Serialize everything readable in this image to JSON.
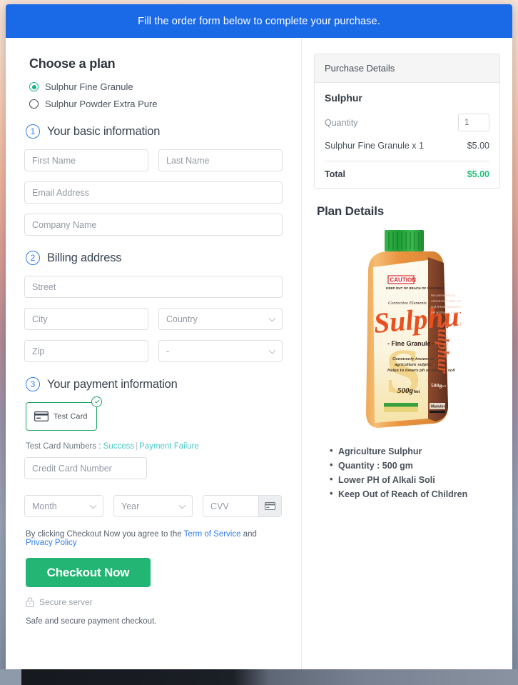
{
  "banner": {
    "text": "Fill the order form below to complete your purchase."
  },
  "plan": {
    "heading": "Choose a plan",
    "options": [
      {
        "label": "Sulphur Fine Granule",
        "selected": true
      },
      {
        "label": "Sulphur Powder Extra Pure",
        "selected": false
      }
    ]
  },
  "steps": {
    "basic": {
      "num": "1",
      "title": "Your basic information"
    },
    "billing": {
      "num": "2",
      "title": "Billing address"
    },
    "payment": {
      "num": "3",
      "title": "Your payment information"
    }
  },
  "fields": {
    "first_name": {
      "placeholder": "First Name",
      "value": ""
    },
    "last_name": {
      "placeholder": "Last Name",
      "value": ""
    },
    "email": {
      "placeholder": "Email Address",
      "value": ""
    },
    "company": {
      "placeholder": "Company Name",
      "value": ""
    },
    "street": {
      "placeholder": "Street",
      "value": ""
    },
    "city": {
      "placeholder": "City",
      "value": ""
    },
    "country": {
      "placeholder": "Country",
      "value": ""
    },
    "zip": {
      "placeholder": "Zip",
      "value": ""
    },
    "state": {
      "placeholder": "-",
      "value": ""
    },
    "credit_card": {
      "placeholder": "Credit Card Number",
      "value": ""
    },
    "month": {
      "placeholder": "Month",
      "value": ""
    },
    "year": {
      "placeholder": "Year",
      "value": ""
    },
    "cvv": {
      "placeholder": "CVV",
      "value": ""
    }
  },
  "payment_method": {
    "label": "Test Card",
    "selected": true,
    "icon": "credit-card-icon",
    "check_icon": "check-circle-icon"
  },
  "test_cards": {
    "prefix": "Test Card Numbers : ",
    "success": "Success",
    "separator": "|",
    "failure": "Payment Failure"
  },
  "agreement": {
    "prefix": "By clicking Checkout Now you agree to the ",
    "tos": "Term of Service",
    "middle": " and ",
    "privacy": "Privacy Policy"
  },
  "checkout": {
    "label": "Checkout Now"
  },
  "secure": {
    "icon": "lock-icon",
    "label": "Secure server"
  },
  "footer_note": "Safe and secure payment checkout.",
  "purchase": {
    "header": "Purchase Details",
    "product": "Sulphur",
    "quantity_label": "Quantity",
    "quantity_value": "1",
    "line_item_label": "Sulphur Fine Granule x 1",
    "line_item_price": "$5.00",
    "total_label": "Total",
    "total_price": "$5.00"
  },
  "plan_details": {
    "heading": "Plan Details",
    "bullets": [
      "Agriculture Sulphur",
      "Quantity : 500 gm",
      "Lower PH of Alkali Soli",
      "Keep Out of Reach of Children"
    ],
    "product_image": {
      "alt": "sulphur-bottle-image",
      "cap_color": "#2aa43c",
      "body_color": "#e8943f",
      "caution_heading": "CAUTION",
      "caution_sub": "KEEP OUT OF REACH OF CHILDREN",
      "eyebrow": "Corrective Elements",
      "brand": "Sulphur",
      "variant": "- Fine Granule -",
      "desc_line1": "Commonly known as",
      "desc_line2": "agriculture sulphur",
      "desc_line3": "Helps to lowers ph of alkaline soil",
      "weight": "500g",
      "weight_unit": "Net",
      "side_weight": "500g Net",
      "side_manu": "Manutec",
      "side_text1": "Recommended for",
      "side_text2": "AZALEAS, CAMELLIAS",
      "side_text3": "and RHODODENDRONS",
      "side_text4": "(All acid loving plants)"
    }
  },
  "colors": {
    "banner_blue": "#1a6ae8",
    "accent_green": "#22b573",
    "total_green": "#22c07a",
    "radio_green": "#15b08a",
    "link_blue": "#2f7dec",
    "link_teal": "#4fc6c7",
    "step_blue": "#2f7dec"
  }
}
